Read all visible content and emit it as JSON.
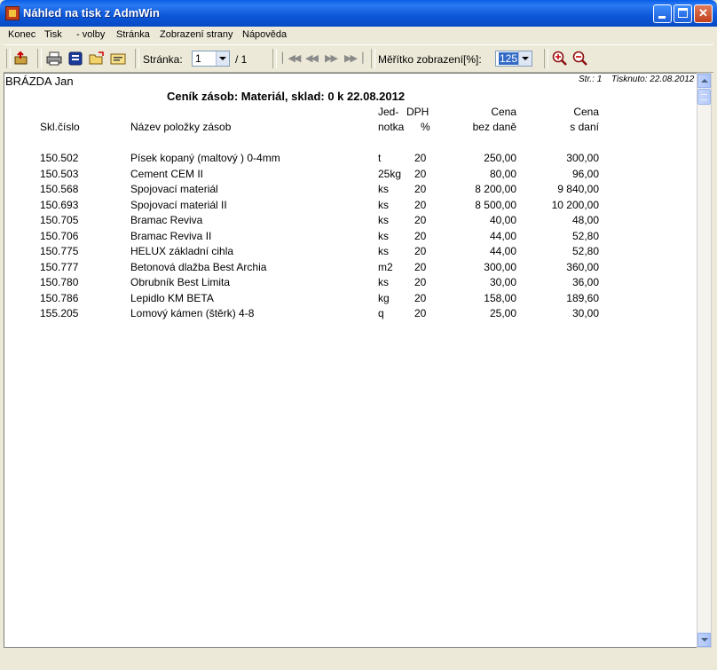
{
  "window": {
    "title": "Náhled na tisk z AdmWin"
  },
  "menu": [
    {
      "label": "Konec"
    },
    {
      "label": "Tisk"
    },
    {
      "label": "- volby"
    },
    {
      "label": "Stránka"
    },
    {
      "label": "Zobrazení strany"
    },
    {
      "label": "Nápověda"
    }
  ],
  "toolbar": {
    "page_label": "Stránka:",
    "page_value": "1",
    "page_total": "/ 1",
    "zoom_label": "Měřítko zobrazení[%]:",
    "zoom_value": "125",
    "icons": [
      "exit-icon",
      "print-icon",
      "print-settings-icon",
      "open-icon",
      "export-icon",
      "first-page-icon",
      "prev-page-icon",
      "next-page-icon",
      "last-page-icon",
      "zoom-in-icon",
      "zoom-out-icon"
    ]
  },
  "report": {
    "company": "BRÁZDA Jan",
    "page_info": "Str.: 1",
    "printed": "Tisknuto: 22.08.2012",
    "title": "Ceník zásob: Materiál, sklad:  0  k 22.08.2012",
    "headers": {
      "code": "Skl.číslo",
      "name": "Název položky zásob",
      "unit_top": "Jed-",
      "unit_bottom": "notka",
      "vat_top": "DPH",
      "vat_bottom": "%",
      "price_top": "Cena",
      "price_bottom": "bez daně",
      "price_vat_top": "Cena",
      "price_vat_bottom": "s daní"
    },
    "rows": [
      {
        "code": "150.502",
        "name": "Písek kopaný (maltový ) 0-4mm",
        "unit": "t",
        "vat": "20",
        "price": "250,00",
        "price_vat": "300,00"
      },
      {
        "code": "150.503",
        "name": "Cement CEM II",
        "unit": "25kg",
        "vat": "20",
        "price": "80,00",
        "price_vat": "96,00"
      },
      {
        "code": "150.568",
        "name": "Spojovací materiál",
        "unit": "ks",
        "vat": "20",
        "price": "8 200,00",
        "price_vat": "9 840,00"
      },
      {
        "code": "150.693",
        "name": "Spojovací materiál II",
        "unit": "ks",
        "vat": "20",
        "price": "8 500,00",
        "price_vat": "10 200,00"
      },
      {
        "code": "150.705",
        "name": "Bramac Reviva",
        "unit": "ks",
        "vat": "20",
        "price": "40,00",
        "price_vat": "48,00"
      },
      {
        "code": "150.706",
        "name": "Bramac Reviva II",
        "unit": "ks",
        "vat": "20",
        "price": "44,00",
        "price_vat": "52,80"
      },
      {
        "code": "150.775",
        "name": "HELUX základní cihla",
        "unit": "ks",
        "vat": "20",
        "price": "44,00",
        "price_vat": "52,80"
      },
      {
        "code": "150.777",
        "name": "Betonová dlažba Best Archia",
        "unit": "m2",
        "vat": "20",
        "price": "300,00",
        "price_vat": "360,00"
      },
      {
        "code": "150.780",
        "name": "Obrubník Best Limita",
        "unit": "ks",
        "vat": "20",
        "price": "30,00",
        "price_vat": "36,00"
      },
      {
        "code": "150.786",
        "name": "Lepidlo KM BETA",
        "unit": "kg",
        "vat": "20",
        "price": "158,00",
        "price_vat": "189,60"
      },
      {
        "code": "155.205",
        "name": "Lomový kámen (štěrk) 4-8",
        "unit": "q",
        "vat": "20",
        "price": "25,00",
        "price_vat": "30,00"
      }
    ]
  }
}
